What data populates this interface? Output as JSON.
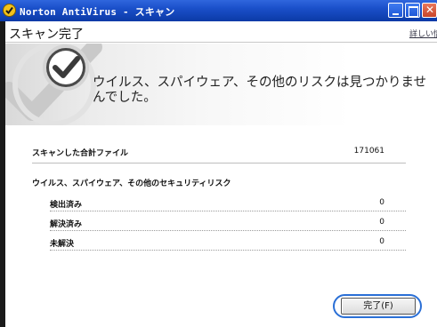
{
  "window": {
    "title": "Norton AntiVirus - スキャン"
  },
  "header": {
    "title": "スキャン完了",
    "details_link": "詳しい情報"
  },
  "banner": {
    "message": "ウイルス、スパイウェア、その他のリスクは見つかりませんでした。"
  },
  "summary": {
    "total_files_label": "スキャンした合計ファイル",
    "total_files_value": "171061",
    "risks_section_label": "ウイルス、スパイウェア、その他のセキュリティリスク",
    "rows": [
      {
        "label": "検出済み",
        "value": "0"
      },
      {
        "label": "解決済み",
        "value": "0"
      },
      {
        "label": "未解決",
        "value": "0"
      }
    ]
  },
  "buttons": {
    "done_label": "完了(F)"
  },
  "colors": {
    "titlebar": "#0b3aa6",
    "focus_ring": "#2a6fd6",
    "check_badge": "#3a3a3a"
  },
  "icons": {
    "app": "norton-shield-icon",
    "banner": "checkmark-icon"
  }
}
